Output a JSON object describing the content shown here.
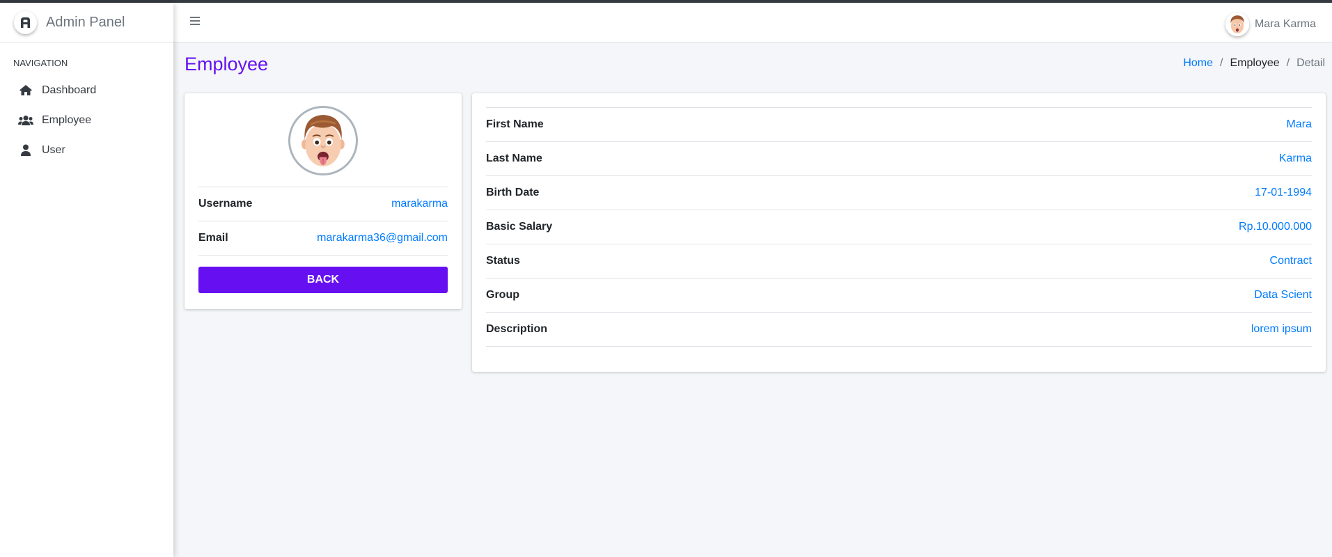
{
  "app": {
    "brand": "Admin Panel",
    "brand_icon": "admin-logo-icon",
    "accent_color": "#6610f2",
    "link_color": "#007bff"
  },
  "navbar": {
    "menu_icon": "hamburger-icon",
    "user_name": "Mara Karma"
  },
  "sidebar": {
    "header": "NAVIGATION",
    "items": [
      {
        "label": "Dashboard",
        "icon": "home-icon"
      },
      {
        "label": "Employee",
        "icon": "users-icon"
      },
      {
        "label": "User",
        "icon": "user-icon"
      }
    ]
  },
  "page": {
    "title": "Employee",
    "breadcrumb": [
      {
        "label": "Home"
      },
      {
        "label": "Employee"
      },
      {
        "label": "Detail"
      }
    ],
    "separator": "/"
  },
  "profile": {
    "fields": [
      {
        "label": "Username",
        "value": "marakarma"
      },
      {
        "label": "Email",
        "value": "marakarma36@gmail.com"
      }
    ],
    "back_label": "BACK"
  },
  "details": {
    "fields": [
      {
        "label": "First Name",
        "value": "Mara"
      },
      {
        "label": "Last Name",
        "value": "Karma"
      },
      {
        "label": "Birth Date",
        "value": "17-01-1994"
      },
      {
        "label": "Basic Salary",
        "value": "Rp.10.000.000"
      },
      {
        "label": "Status",
        "value": "Contract"
      },
      {
        "label": "Group",
        "value": "Data Scient"
      },
      {
        "label": "Description",
        "value": "lorem ipsum"
      }
    ]
  }
}
